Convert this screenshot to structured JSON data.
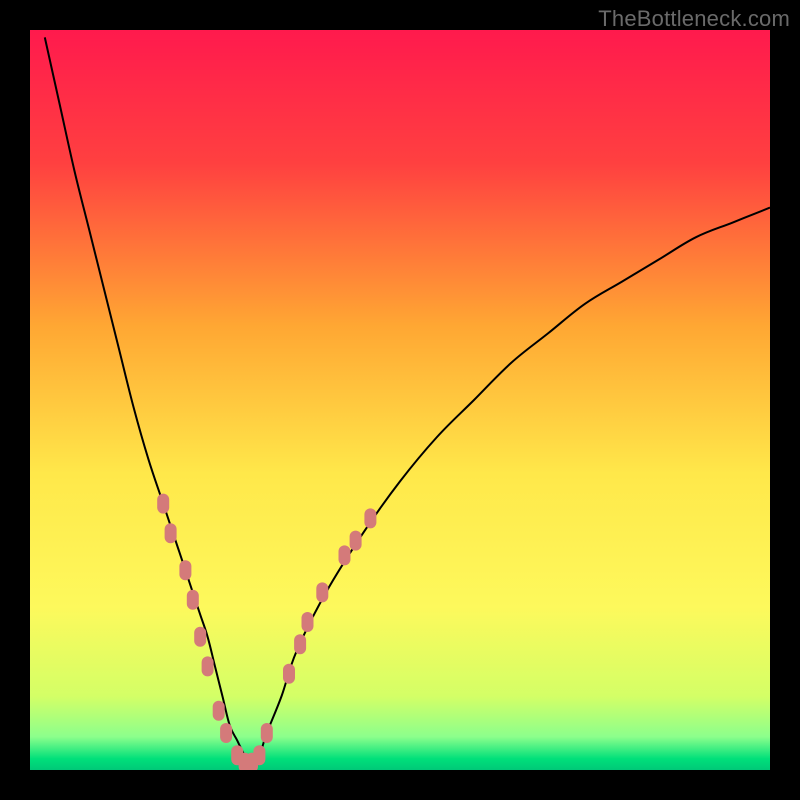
{
  "watermark": "TheBottleneck.com",
  "chart_data": {
    "type": "line",
    "title": "",
    "xlabel": "",
    "ylabel": "",
    "xlim": [
      0,
      100
    ],
    "ylim": [
      0,
      100
    ],
    "grid": false,
    "legend": false,
    "background": {
      "type": "vertical-gradient",
      "stops": [
        {
          "offset": 0.0,
          "color": "#ff1a4d"
        },
        {
          "offset": 0.18,
          "color": "#ff4040"
        },
        {
          "offset": 0.4,
          "color": "#ffa733"
        },
        {
          "offset": 0.6,
          "color": "#ffe84a"
        },
        {
          "offset": 0.78,
          "color": "#fdf95c"
        },
        {
          "offset": 0.9,
          "color": "#d4ff66"
        },
        {
          "offset": 0.955,
          "color": "#8cff8c"
        },
        {
          "offset": 0.985,
          "color": "#00e07a"
        },
        {
          "offset": 1.0,
          "color": "#00c878"
        }
      ]
    },
    "series": [
      {
        "name": "curve",
        "stroke": "#000000",
        "stroke_width": 2,
        "x": [
          2,
          4,
          6,
          8,
          10,
          12,
          14,
          16,
          18,
          20,
          22,
          23,
          24,
          25,
          26,
          27,
          28,
          29,
          30,
          31,
          32,
          34,
          36,
          40,
          45,
          50,
          55,
          60,
          65,
          70,
          75,
          80,
          85,
          90,
          95,
          100
        ],
        "y": [
          99,
          90,
          81,
          73,
          65,
          57,
          49,
          42,
          36,
          30,
          24,
          21,
          18,
          14,
          10,
          6,
          4,
          2,
          1,
          2,
          5,
          10,
          16,
          24,
          32,
          39,
          45,
          50,
          55,
          59,
          63,
          66,
          69,
          72,
          74,
          76
        ]
      }
    ],
    "markers": {
      "name": "dots",
      "shape": "rounded-capsule",
      "color": "#d47a7a",
      "rx": 6,
      "ry": 10,
      "points": [
        {
          "x": 18.0,
          "y": 36
        },
        {
          "x": 19.0,
          "y": 32
        },
        {
          "x": 21.0,
          "y": 27
        },
        {
          "x": 22.0,
          "y": 23
        },
        {
          "x": 23.0,
          "y": 18
        },
        {
          "x": 24.0,
          "y": 14
        },
        {
          "x": 25.5,
          "y": 8
        },
        {
          "x": 26.5,
          "y": 5
        },
        {
          "x": 28.0,
          "y": 2
        },
        {
          "x": 29.0,
          "y": 1
        },
        {
          "x": 30.0,
          "y": 1
        },
        {
          "x": 31.0,
          "y": 2
        },
        {
          "x": 32.0,
          "y": 5
        },
        {
          "x": 35.0,
          "y": 13
        },
        {
          "x": 36.5,
          "y": 17
        },
        {
          "x": 37.5,
          "y": 20
        },
        {
          "x": 39.5,
          "y": 24
        },
        {
          "x": 42.5,
          "y": 29
        },
        {
          "x": 44.0,
          "y": 31
        },
        {
          "x": 46.0,
          "y": 34
        }
      ]
    }
  }
}
